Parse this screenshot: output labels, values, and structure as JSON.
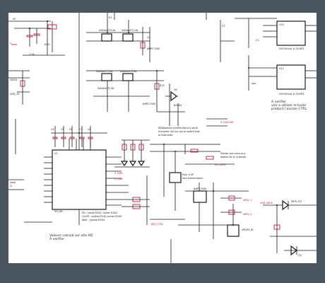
{
  "notes": {
    "right_top": [
      "A verifier",
      "voir a utiliser le tuner",
      "product l'ancien CTRL"
    ],
    "bottom_left": [
      "Valeurs calculé sur site AD",
      "A verifier"
    ],
    "mid_right": [
      "R2Bdarlicks (breflie dans la serie",
      "d'origine: les sur cps le switch test",
      "ar/marneles"
    ],
    "power_label": "Pour a SP",
    "power_label2": "Sort alimentation",
    "led_label": [
      "Diodes lab cours aux",
      "diodes de la la bmoje"
    ],
    "bottom_mid": [
      "EN : zeshe R162, entier R162",
      "OnOff : routine R161 entier R163",
      "Wait : (passe R164"
    ]
  },
  "ic_labels": {
    "u_top_right_1": "LM7iUmnti-1t SOVR1",
    "u_top_right_2": "LM7iUmnti-1t SOVR1",
    "u_main": "PIC18F..."
  },
  "net_labels": {
    "vcc_left": "5V",
    "pwm_1": "P_CMD",
    "pwm_2": "E_CMD",
    "out_a": "SCL_SPI+",
    "out_b": "SDA_SPI-",
    "servo_1": "SERV_1",
    "servo_2": "SERV_2",
    "bat_mon": "BAT_CTRL",
    "mid_in": "IN_AD2",
    "right_in": "USB_VBUS",
    "right_out": "PRTS_FLT",
    "led_net": "LED_CTRL",
    "r_gauche": "R_GAUCHE",
    "supply_2": "VPLM3_RL"
  }
}
